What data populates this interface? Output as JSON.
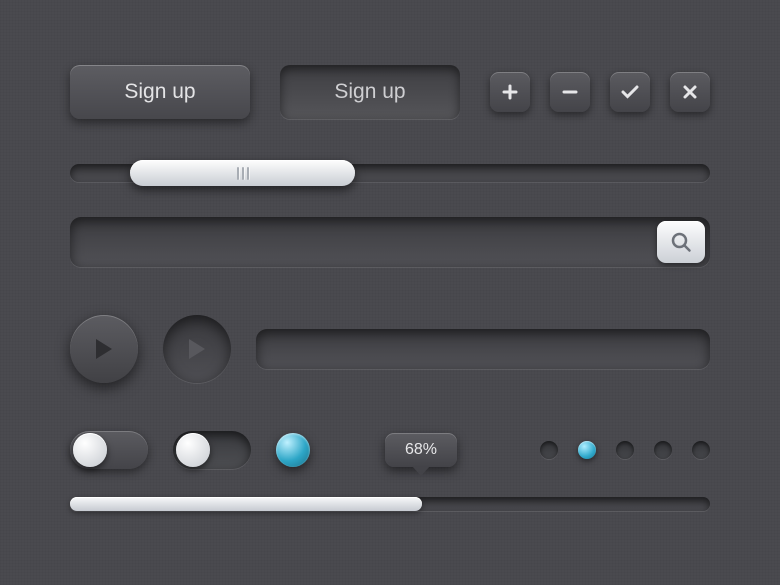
{
  "buttons": {
    "sign_up_raised": "Sign up",
    "sign_up_inset": "Sign up"
  },
  "icon_buttons": {
    "plus": "plus-icon",
    "minus": "minus-icon",
    "check": "check-icon",
    "close": "close-icon"
  },
  "slider": {
    "position_percent": 9
  },
  "search": {
    "placeholder": "",
    "value": ""
  },
  "toggles": {
    "toggle1": false,
    "toggle2": false
  },
  "colors": {
    "accent": "#2fa9cb"
  },
  "tooltip": {
    "label": "68%"
  },
  "pagination": {
    "dots_total": 5,
    "active_index": 1
  },
  "progress": {
    "percent": 55
  }
}
